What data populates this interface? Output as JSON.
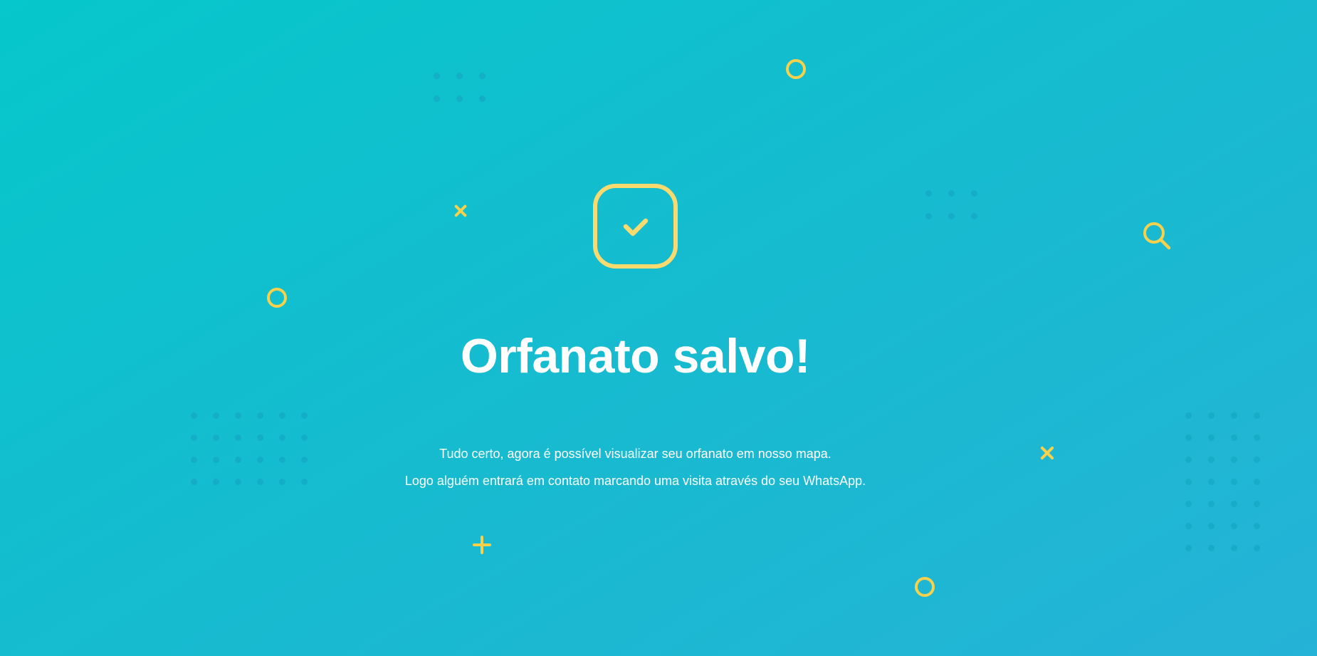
{
  "confirmation": {
    "title": "Orfanato salvo!",
    "message_line_1": "Tudo certo, agora é possível visualizar seu orfanato em nosso mapa.",
    "message_line_2": "Logo alguém entrará em contato marcando uma visita através do seu WhatsApp."
  },
  "colors": {
    "background_start": "#06c7cb",
    "background_end": "#25b3d7",
    "accent_yellow": "#f7d14c",
    "text": "#ffffff",
    "dot_pattern": "#14a8c4"
  },
  "icons": {
    "success": "checkmark-in-rounded-square-icon",
    "decorations": [
      "circle-icon",
      "x-icon",
      "plus-icon",
      "magnifier-icon",
      "dot-grid"
    ]
  }
}
